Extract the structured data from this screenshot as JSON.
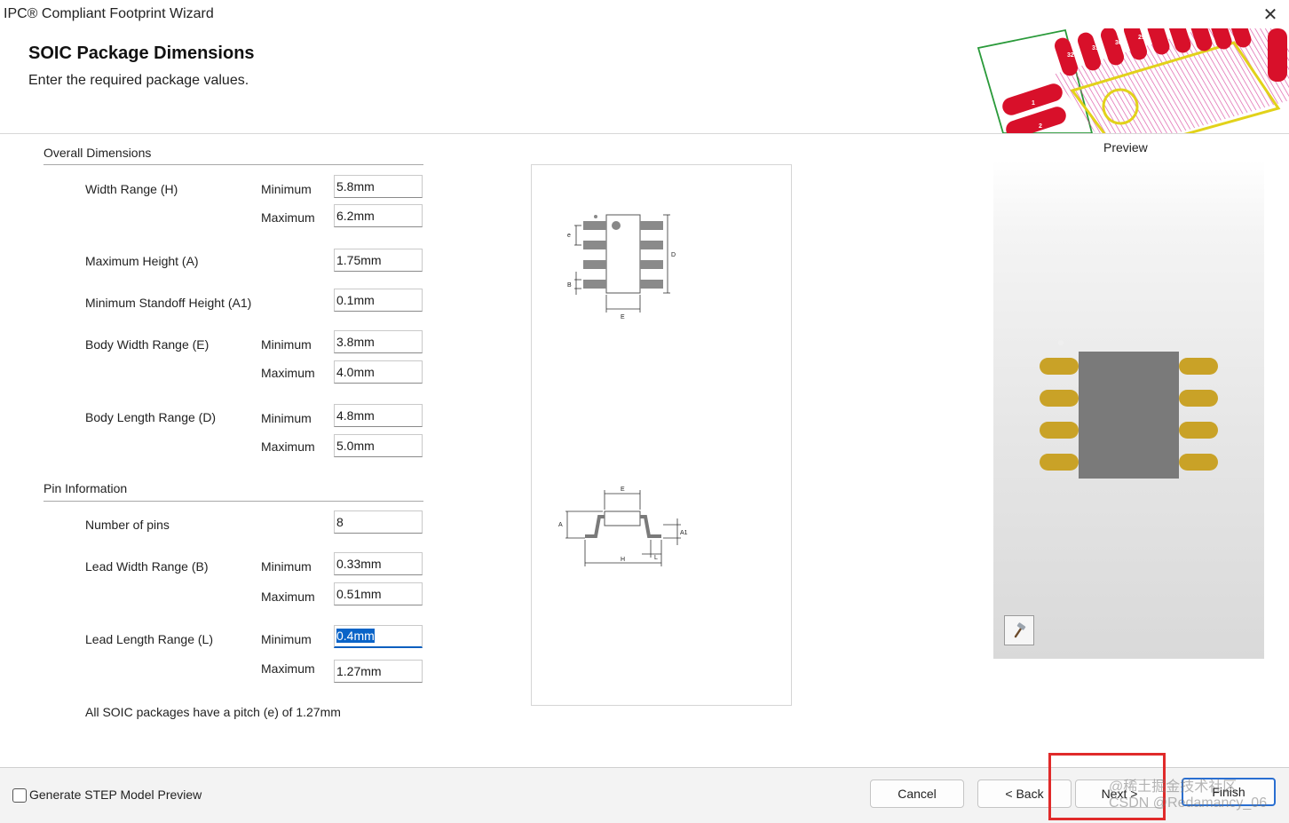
{
  "window": {
    "title": "IPC® Compliant Footprint Wizard",
    "close_icon": "close-icon"
  },
  "header": {
    "title": "SOIC Package Dimensions",
    "subtitle": "Enter the required package values."
  },
  "overall": {
    "heading": "Overall Dimensions",
    "width_range": {
      "label": "Width Range (H)",
      "min_label": "Minimum",
      "max_label": "Maximum",
      "min": "5.8mm",
      "max": "6.2mm"
    },
    "max_height": {
      "label": "Maximum Height (A)",
      "value": "1.75mm"
    },
    "min_standoff": {
      "label": "Minimum Standoff Height (A1)",
      "value": "0.1mm"
    },
    "body_width": {
      "label": "Body Width Range (E)",
      "min_label": "Minimum",
      "max_label": "Maximum",
      "min": "3.8mm",
      "max": "4.0mm"
    },
    "body_length": {
      "label": "Body Length Range (D)",
      "min_label": "Minimum",
      "max_label": "Maximum",
      "min": "4.8mm",
      "max": "5.0mm"
    }
  },
  "pins": {
    "heading": "Pin Information",
    "number": {
      "label": "Number of pins",
      "value": "8"
    },
    "lead_width": {
      "label": "Lead Width Range (B)",
      "min_label": "Minimum",
      "max_label": "Maximum",
      "min": "0.33mm",
      "max": "0.51mm"
    },
    "lead_length": {
      "label": "Lead Length Range (L)",
      "min_label": "Minimum",
      "max_label": "Maximum",
      "min": "0.4mm",
      "max": "1.27mm"
    },
    "note": "All SOIC packages have a pitch (e) of 1.27mm"
  },
  "diagram": {
    "top_labels": {
      "e": "e",
      "B": "B",
      "D": "D",
      "E": "E"
    },
    "side_labels": {
      "E": "E",
      "A": "A",
      "A1": "A1",
      "H": "H",
      "L": "L"
    }
  },
  "banner": {
    "pin_numbers": [
      "32",
      "31",
      "30",
      "29",
      "1",
      "2"
    ]
  },
  "preview": {
    "label": "Preview",
    "tool_icon": "hammer-icon"
  },
  "footer": {
    "step_label": "Generate STEP Model Preview",
    "step_checked": false,
    "cancel": "Cancel",
    "back": "< Back",
    "next": "Next >",
    "finish": "Finish"
  },
  "watermark": {
    "line1": "@稀土掘金技术社区",
    "line2": "CSDN @Redamancy_06"
  },
  "colors": {
    "highlight": "#e02a2a",
    "pad_gold": "#c9a227",
    "body_gray": "#7a7a7a",
    "banner_red": "#d8102a",
    "focus_blue": "#0a64c8"
  }
}
